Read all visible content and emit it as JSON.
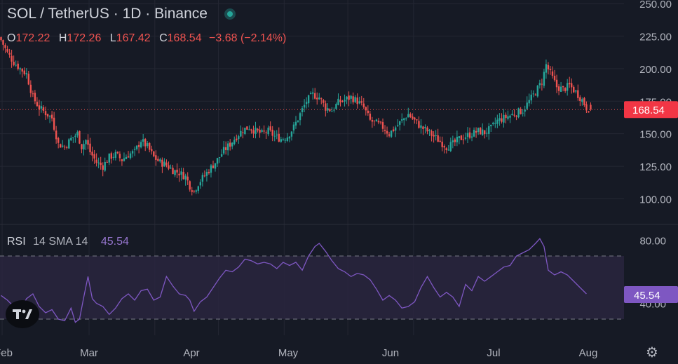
{
  "header": {
    "title": "SOL / TetherUS · 1D · Binance",
    "ohlc": {
      "o_label": "O",
      "o": "172.22",
      "h_label": "H",
      "h": "172.26",
      "l_label": "L",
      "l": "167.42",
      "c_label": "C",
      "c": "168.54",
      "change": "−3.68 (−2.14%)"
    }
  },
  "rsi_panel": {
    "label": "RSI",
    "params": "14 SMA 14",
    "value": "45.54"
  },
  "colors": {
    "background": "#161a25",
    "up": "#26a69a",
    "down": "#ef5350",
    "rsi_line": "#7e57c2",
    "rsi_band": "#2a2540",
    "grid": "#242733",
    "price_label_bg": "#f23645",
    "rsi_label_bg": "#7e57c2"
  },
  "icons": {
    "logo": "tradingview-logo-icon",
    "settings": "gear-icon",
    "status": "market-open-dot-icon"
  },
  "chart_data": [
    {
      "type": "candlestick",
      "price_axis_ticks": [
        "250.00",
        "225.00",
        "200.00",
        "175.00",
        "150.00",
        "125.00",
        "100.00"
      ],
      "ylim": [
        85,
        252
      ],
      "last_price_label": "168.54",
      "last_price": 168.54,
      "time_axis_labels": [
        "Feb",
        "Mar",
        "Apr",
        "May",
        "Jun",
        "Jul",
        "Aug"
      ],
      "close_path": [
        [
          0,
          222
        ],
        [
          3,
          212
        ],
        [
          6,
          205
        ],
        [
          9,
          200
        ],
        [
          12,
          196
        ],
        [
          15,
          178
        ],
        [
          18,
          170
        ],
        [
          21,
          166
        ],
        [
          24,
          162
        ],
        [
          27,
          142
        ],
        [
          30,
          140
        ],
        [
          33,
          146
        ],
        [
          36,
          150
        ],
        [
          38,
          140
        ],
        [
          40,
          145
        ],
        [
          42,
          136
        ],
        [
          45,
          128
        ],
        [
          48,
          125
        ],
        [
          51,
          132
        ],
        [
          54,
          134
        ],
        [
          57,
          130
        ],
        [
          60,
          134
        ],
        [
          63,
          136
        ],
        [
          66,
          145
        ],
        [
          69,
          140
        ],
        [
          72,
          132
        ],
        [
          75,
          128
        ],
        [
          78,
          126
        ],
        [
          81,
          122
        ],
        [
          84,
          120
        ],
        [
          87,
          117
        ],
        [
          89,
          110
        ],
        [
          91,
          106
        ],
        [
          93,
          112
        ],
        [
          96,
          118
        ],
        [
          99,
          124
        ],
        [
          102,
          130
        ],
        [
          105,
          137
        ],
        [
          108,
          142
        ],
        [
          111,
          148
        ],
        [
          114,
          153
        ],
        [
          117,
          155
        ],
        [
          120,
          152
        ],
        [
          123,
          150
        ],
        [
          126,
          152
        ],
        [
          129,
          148
        ],
        [
          132,
          146
        ],
        [
          135,
          148
        ],
        [
          138,
          155
        ],
        [
          141,
          165
        ],
        [
          144,
          175
        ],
        [
          147,
          180
        ],
        [
          150,
          178
        ],
        [
          153,
          170
        ],
        [
          156,
          168
        ],
        [
          159,
          174
        ],
        [
          162,
          176
        ],
        [
          165,
          178
        ],
        [
          168,
          175
        ],
        [
          171,
          170
        ],
        [
          174,
          160
        ],
        [
          177,
          158
        ],
        [
          180,
          155
        ],
        [
          183,
          150
        ],
        [
          186,
          155
        ],
        [
          189,
          160
        ],
        [
          192,
          165
        ],
        [
          195,
          160
        ],
        [
          198,
          155
        ],
        [
          201,
          152
        ],
        [
          204,
          148
        ],
        [
          207,
          144
        ],
        [
          210,
          140
        ],
        [
          213,
          142
        ],
        [
          216,
          146
        ],
        [
          219,
          148
        ],
        [
          222,
          150
        ],
        [
          225,
          152
        ],
        [
          228,
          151
        ],
        [
          231,
          154
        ],
        [
          234,
          160
        ],
        [
          237,
          162
        ],
        [
          240,
          164
        ],
        [
          243,
          166
        ],
        [
          246,
          168
        ],
        [
          249,
          175
        ],
        [
          252,
          182
        ],
        [
          255,
          190
        ],
        [
          257,
          203
        ],
        [
          259,
          196
        ],
        [
          262,
          186
        ],
        [
          265,
          184
        ],
        [
          268,
          187
        ],
        [
          271,
          182
        ],
        [
          274,
          176
        ],
        [
          276,
          170
        ],
        [
          278,
          168.54
        ]
      ]
    },
    {
      "type": "line",
      "name": "RSI",
      "level_ticks": [
        "80.00",
        "40.00"
      ],
      "value_label": "45.54",
      "last_value": 45.54,
      "band": [
        30,
        70
      ],
      "ylim": [
        22,
        85
      ],
      "path": [
        [
          0,
          45
        ],
        [
          3,
          42
        ],
        [
          6,
          38
        ],
        [
          9,
          35
        ],
        [
          12,
          43
        ],
        [
          15,
          46
        ],
        [
          18,
          38
        ],
        [
          21,
          34
        ],
        [
          24,
          36
        ],
        [
          27,
          30
        ],
        [
          30,
          29
        ],
        [
          33,
          37
        ],
        [
          35,
          28
        ],
        [
          37,
          30
        ],
        [
          39,
          44
        ],
        [
          41,
          57
        ],
        [
          43,
          43
        ],
        [
          45,
          40
        ],
        [
          48,
          38
        ],
        [
          51,
          33
        ],
        [
          54,
          37
        ],
        [
          57,
          43
        ],
        [
          60,
          46
        ],
        [
          63,
          42
        ],
        [
          66,
          48
        ],
        [
          69,
          49
        ],
        [
          72,
          42
        ],
        [
          75,
          44
        ],
        [
          78,
          57
        ],
        [
          81,
          51
        ],
        [
          84,
          46
        ],
        [
          87,
          45
        ],
        [
          89,
          42
        ],
        [
          91,
          35
        ],
        [
          94,
          41
        ],
        [
          97,
          44
        ],
        [
          100,
          50
        ],
        [
          103,
          56
        ],
        [
          106,
          61
        ],
        [
          109,
          60
        ],
        [
          112,
          63
        ],
        [
          115,
          68
        ],
        [
          118,
          67
        ],
        [
          121,
          65
        ],
        [
          124,
          66
        ],
        [
          127,
          65
        ],
        [
          130,
          62
        ],
        [
          133,
          66
        ],
        [
          136,
          64
        ],
        [
          139,
          66
        ],
        [
          142,
          61
        ],
        [
          145,
          70
        ],
        [
          148,
          76
        ],
        [
          150,
          78
        ],
        [
          153,
          73
        ],
        [
          156,
          67
        ],
        [
          159,
          62
        ],
        [
          162,
          60
        ],
        [
          165,
          57
        ],
        [
          168,
          59
        ],
        [
          171,
          58
        ],
        [
          174,
          55
        ],
        [
          177,
          49
        ],
        [
          180,
          42
        ],
        [
          183,
          45
        ],
        [
          186,
          42
        ],
        [
          189,
          37
        ],
        [
          192,
          38
        ],
        [
          195,
          41
        ],
        [
          198,
          50
        ],
        [
          201,
          57
        ],
        [
          204,
          50
        ],
        [
          207,
          44
        ],
        [
          210,
          47
        ],
        [
          213,
          44
        ],
        [
          216,
          38
        ],
        [
          219,
          52
        ],
        [
          222,
          48
        ],
        [
          225,
          57
        ],
        [
          228,
          54
        ],
        [
          231,
          57
        ],
        [
          234,
          60
        ],
        [
          237,
          63
        ],
        [
          240,
          64
        ],
        [
          243,
          70
        ],
        [
          246,
          72
        ],
        [
          249,
          74
        ],
        [
          252,
          78
        ],
        [
          254,
          81
        ],
        [
          256,
          76
        ],
        [
          258,
          61
        ],
        [
          261,
          58
        ],
        [
          264,
          60
        ],
        [
          267,
          58
        ],
        [
          270,
          54
        ],
        [
          273,
          50
        ],
        [
          276,
          46
        ]
      ]
    }
  ]
}
